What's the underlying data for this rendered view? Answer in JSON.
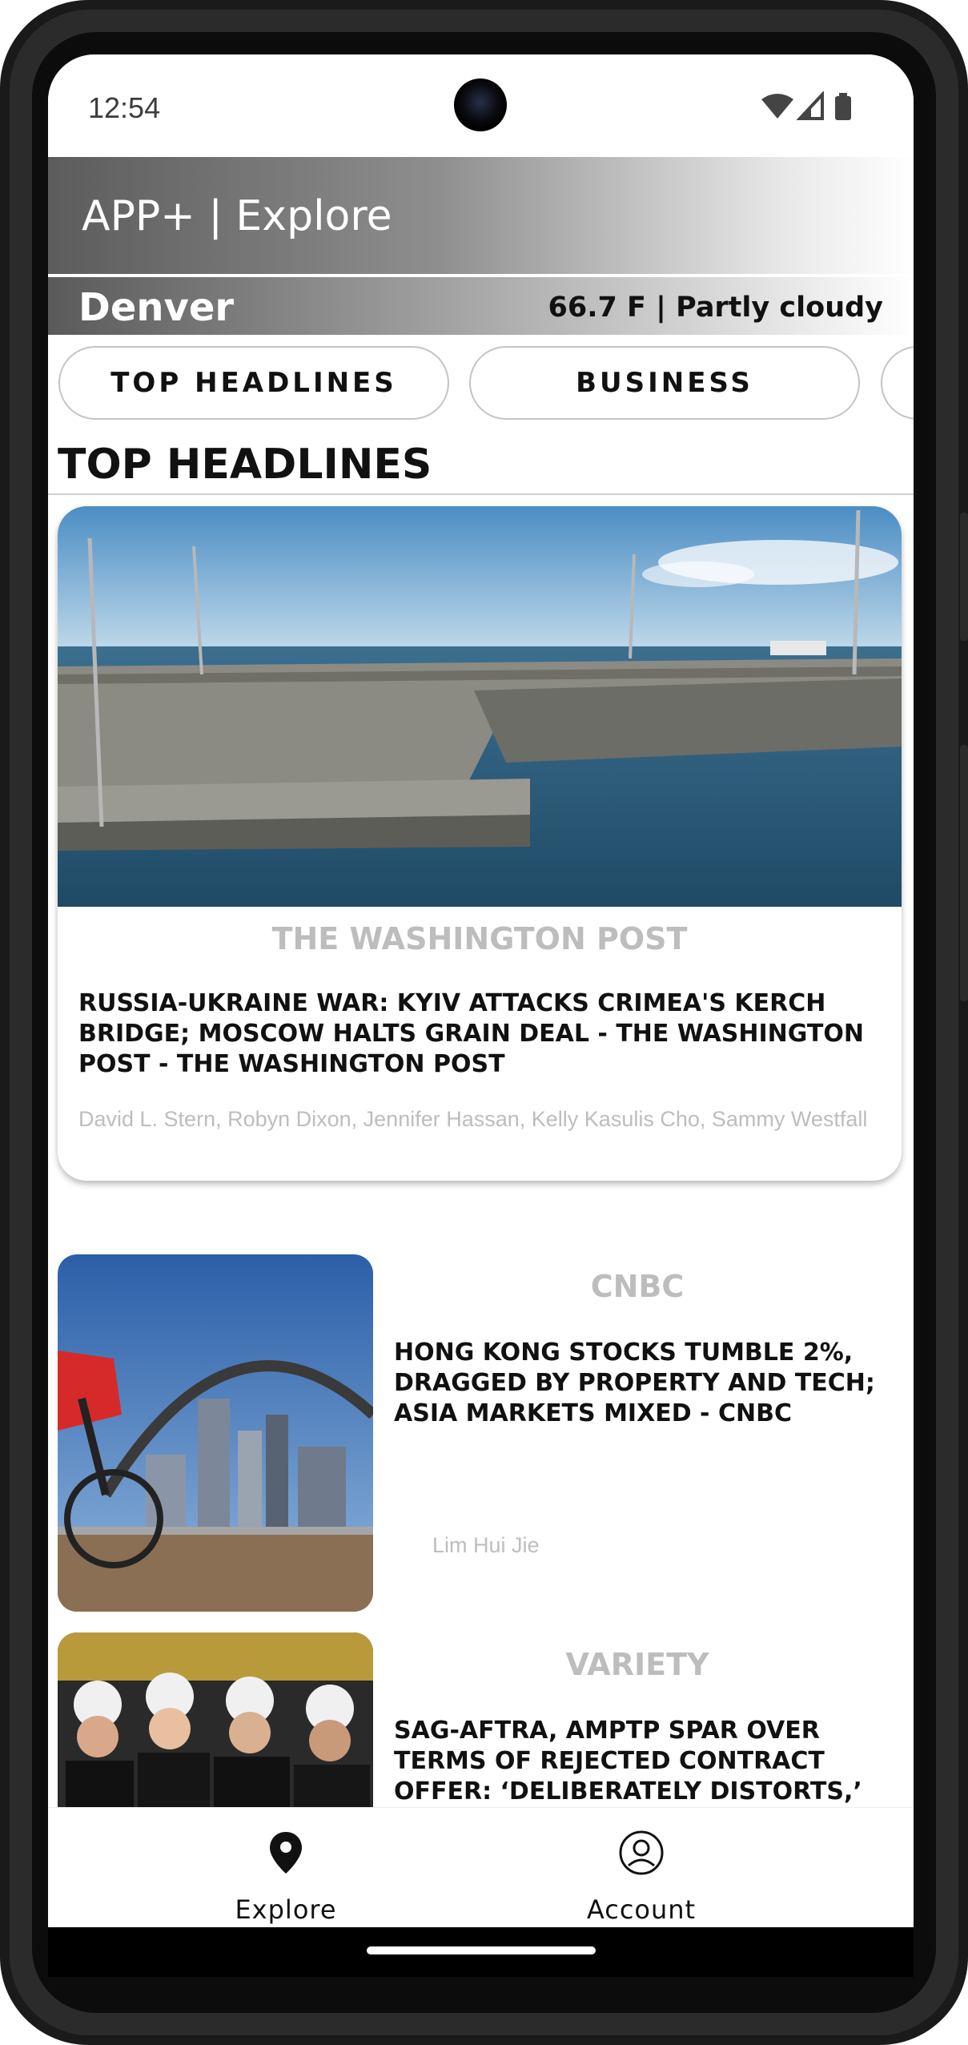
{
  "status_bar": {
    "time": "12:54"
  },
  "app_bar": {
    "title": "APP+ | Explore"
  },
  "weather": {
    "city": "Denver",
    "summary": "66.7 F | Partly cloudy"
  },
  "categories": [
    "TOP HEADLINES",
    "BUSINESS"
  ],
  "section": {
    "title": "TOP HEADLINES"
  },
  "articles": [
    {
      "source": "THE WASHINGTON POST",
      "headline": "RUSSIA-UKRAINE WAR: KYIV ATTACKS CRIMEA'S KERCH BRIDGE; MOSCOW HALTS GRAIN DEAL - THE WASHINGTON POST - THE WASHINGTON POST",
      "author": "David L. Stern, Robyn Dixon, Jennifer Hassan, Kelly Kasulis Cho, Sammy Westfall",
      "image": "damaged bridge over sea"
    },
    {
      "source": "CNBC",
      "headline": "HONG KONG STOCKS TUMBLE 2%, DRAGGED BY PROPERTY AND TECH; ASIA MARKETS MIXED - CNBC",
      "author": "Lim Hui Jie",
      "image": "cyclist on bridge with city skyline"
    },
    {
      "source": "VARIETY",
      "headline": "SAG-AFTRA, AMPTP SPAR OVER TERMS OF REJECTED CONTRACT OFFER: ‘DELIBERATELY DISTORTS,’ SAYS AMPTP; ‘REWARDED FOR EXPLOITING WORKERS,’ SAYS UNION - VARIETY",
      "image": "group of SAG-AFTRA strikers"
    }
  ],
  "bottom_nav": [
    {
      "label": "Explore",
      "icon": "location-pin-icon"
    },
    {
      "label": "Account",
      "icon": "account-circle-icon"
    }
  ]
}
